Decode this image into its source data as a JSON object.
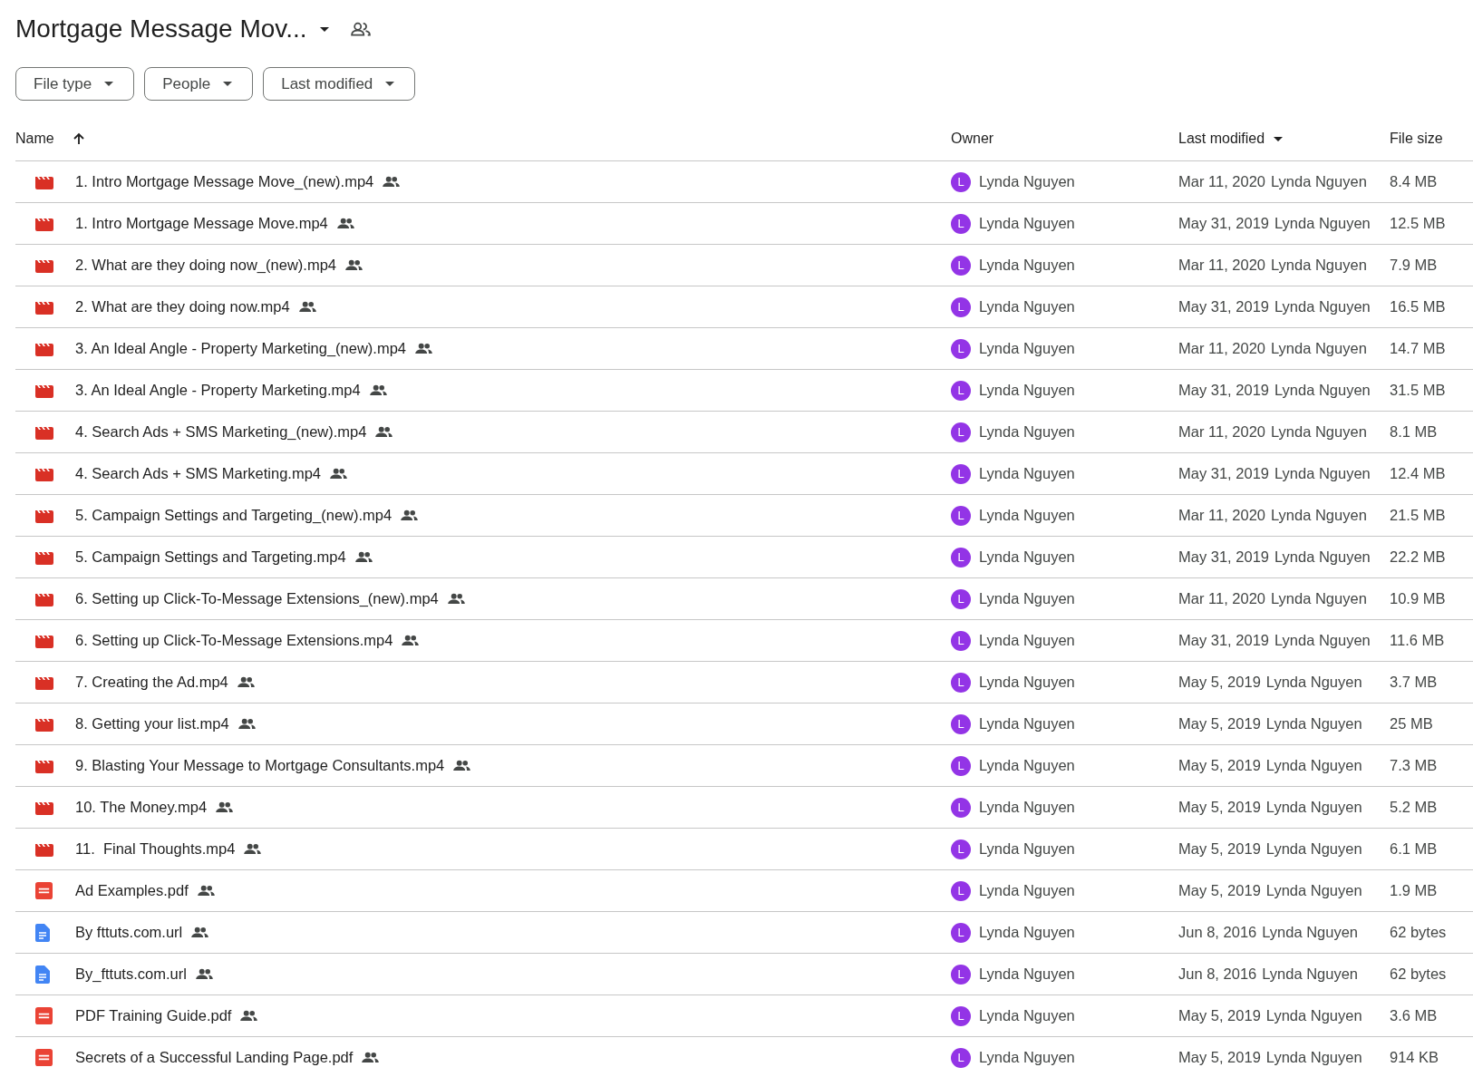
{
  "header": {
    "title": "Mortgage Message Mov...",
    "shared": true
  },
  "filters": [
    {
      "label": "File type"
    },
    {
      "label": "People"
    },
    {
      "label": "Last modified"
    }
  ],
  "table": {
    "columns": [
      {
        "label": "Name",
        "sorted": true,
        "ascending": true
      },
      {
        "label": "Owner",
        "sorted": false
      },
      {
        "label": "Last modified",
        "sorted": true,
        "ascending": false
      },
      {
        "label": "File size",
        "sorted": false
      }
    ],
    "rows": [
      {
        "kind": "video",
        "name": "1. Intro Mortgage Message Move_(new).mp4",
        "shared": true,
        "owner_initial": "L",
        "owner": "Lynda Nguyen",
        "modified": "Mar 11, 2020",
        "modified_by": "Lynda Nguyen",
        "size": "8.4 MB"
      },
      {
        "kind": "video",
        "name": "1. Intro Mortgage Message Move.mp4",
        "shared": true,
        "owner_initial": "L",
        "owner": "Lynda Nguyen",
        "modified": "May 31, 2019",
        "modified_by": "Lynda Nguyen",
        "size": "12.5 MB"
      },
      {
        "kind": "video",
        "name": "2. What are they doing now_(new).mp4",
        "shared": true,
        "owner_initial": "L",
        "owner": "Lynda Nguyen",
        "modified": "Mar 11, 2020",
        "modified_by": "Lynda Nguyen",
        "size": "7.9 MB"
      },
      {
        "kind": "video",
        "name": "2. What are they doing now.mp4",
        "shared": true,
        "owner_initial": "L",
        "owner": "Lynda Nguyen",
        "modified": "May 31, 2019",
        "modified_by": "Lynda Nguyen",
        "size": "16.5 MB"
      },
      {
        "kind": "video",
        "name": "3. An Ideal Angle - Property Marketing_(new).mp4",
        "shared": true,
        "owner_initial": "L",
        "owner": "Lynda Nguyen",
        "modified": "Mar 11, 2020",
        "modified_by": "Lynda Nguyen",
        "size": "14.7 MB"
      },
      {
        "kind": "video",
        "name": "3. An Ideal Angle - Property Marketing.mp4",
        "shared": true,
        "owner_initial": "L",
        "owner": "Lynda Nguyen",
        "modified": "May 31, 2019",
        "modified_by": "Lynda Nguyen",
        "size": "31.5 MB"
      },
      {
        "kind": "video",
        "name": "4. Search Ads + SMS Marketing_(new).mp4",
        "shared": true,
        "owner_initial": "L",
        "owner": "Lynda Nguyen",
        "modified": "Mar 11, 2020",
        "modified_by": "Lynda Nguyen",
        "size": "8.1 MB"
      },
      {
        "kind": "video",
        "name": "4. Search Ads + SMS Marketing.mp4",
        "shared": true,
        "owner_initial": "L",
        "owner": "Lynda Nguyen",
        "modified": "May 31, 2019",
        "modified_by": "Lynda Nguyen",
        "size": "12.4 MB"
      },
      {
        "kind": "video",
        "name": "5. Campaign Settings and Targeting_(new).mp4",
        "shared": true,
        "owner_initial": "L",
        "owner": "Lynda Nguyen",
        "modified": "Mar 11, 2020",
        "modified_by": "Lynda Nguyen",
        "size": "21.5 MB"
      },
      {
        "kind": "video",
        "name": "5. Campaign Settings and Targeting.mp4",
        "shared": true,
        "owner_initial": "L",
        "owner": "Lynda Nguyen",
        "modified": "May 31, 2019",
        "modified_by": "Lynda Nguyen",
        "size": "22.2 MB"
      },
      {
        "kind": "video",
        "name": "6. Setting up Click-To-Message Extensions_(new).mp4",
        "shared": true,
        "owner_initial": "L",
        "owner": "Lynda Nguyen",
        "modified": "Mar 11, 2020",
        "modified_by": "Lynda Nguyen",
        "size": "10.9 MB"
      },
      {
        "kind": "video",
        "name": "6. Setting up Click-To-Message Extensions.mp4",
        "shared": true,
        "owner_initial": "L",
        "owner": "Lynda Nguyen",
        "modified": "May 31, 2019",
        "modified_by": "Lynda Nguyen",
        "size": "11.6 MB"
      },
      {
        "kind": "video",
        "name": "7. Creating the Ad.mp4",
        "shared": true,
        "owner_initial": "L",
        "owner": "Lynda Nguyen",
        "modified": "May 5, 2019",
        "modified_by": "Lynda Nguyen",
        "size": "3.7 MB"
      },
      {
        "kind": "video",
        "name": "8. Getting your list.mp4",
        "shared": true,
        "owner_initial": "L",
        "owner": "Lynda Nguyen",
        "modified": "May 5, 2019",
        "modified_by": "Lynda Nguyen",
        "size": "25 MB"
      },
      {
        "kind": "video",
        "name": "9. Blasting Your Message to Mortgage Consultants.mp4",
        "shared": true,
        "owner_initial": "L",
        "owner": "Lynda Nguyen",
        "modified": "May 5, 2019",
        "modified_by": "Lynda Nguyen",
        "size": "7.3 MB"
      },
      {
        "kind": "video",
        "name": "10. The Money.mp4",
        "shared": true,
        "owner_initial": "L",
        "owner": "Lynda Nguyen",
        "modified": "May 5, 2019",
        "modified_by": "Lynda Nguyen",
        "size": "5.2 MB"
      },
      {
        "kind": "video",
        "name": "11.  Final Thoughts.mp4",
        "shared": true,
        "owner_initial": "L",
        "owner": "Lynda Nguyen",
        "modified": "May 5, 2019",
        "modified_by": "Lynda Nguyen",
        "size": "6.1 MB"
      },
      {
        "kind": "pdf",
        "name": "Ad Examples.pdf",
        "shared": true,
        "owner_initial": "L",
        "owner": "Lynda Nguyen",
        "modified": "May 5, 2019",
        "modified_by": "Lynda Nguyen",
        "size": "1.9 MB"
      },
      {
        "kind": "doc",
        "name": "By fttuts.com.url",
        "shared": true,
        "owner_initial": "L",
        "owner": "Lynda Nguyen",
        "modified": "Jun 8, 2016",
        "modified_by": "Lynda Nguyen",
        "size": "62 bytes"
      },
      {
        "kind": "doc",
        "name": "By_fttuts.com.url",
        "shared": true,
        "owner_initial": "L",
        "owner": "Lynda Nguyen",
        "modified": "Jun 8, 2016",
        "modified_by": "Lynda Nguyen",
        "size": "62 bytes"
      },
      {
        "kind": "pdf",
        "name": "PDF Training Guide.pdf",
        "shared": true,
        "owner_initial": "L",
        "owner": "Lynda Nguyen",
        "modified": "May 5, 2019",
        "modified_by": "Lynda Nguyen",
        "size": "3.6 MB"
      },
      {
        "kind": "pdf",
        "name": "Secrets of a Successful Landing Page.pdf",
        "shared": true,
        "owner_initial": "L",
        "owner": "Lynda Nguyen",
        "modified": "May 5, 2019",
        "modified_by": "Lynda Nguyen",
        "size": "914 KB"
      }
    ]
  }
}
